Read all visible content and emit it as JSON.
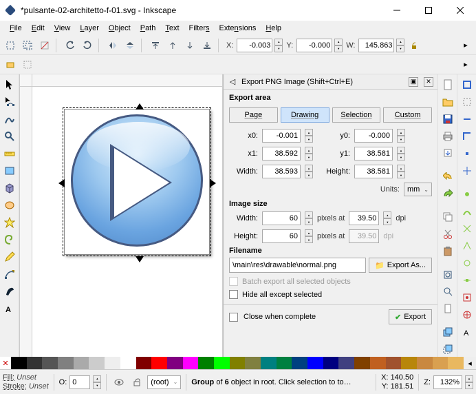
{
  "window": {
    "title": "*pulsante-02-architetto-f-01.svg - Inkscape"
  },
  "menu": [
    "File",
    "Edit",
    "View",
    "Layer",
    "Object",
    "Path",
    "Text",
    "Filters",
    "Extensions",
    "Help"
  ],
  "coordbar": {
    "x_label": "X:",
    "x_value": "-0.003",
    "y_label": "Y:",
    "y_value": "-0.000",
    "w_label": "W:",
    "w_value": "145.863"
  },
  "export": {
    "panel_title": "Export PNG Image (Shift+Ctrl+E)",
    "area_heading": "Export area",
    "tabs": {
      "page": "Page",
      "drawing": "Drawing",
      "selection": "Selection",
      "custom": "Custom"
    },
    "x0_label": "x0:",
    "x0": "-0.001",
    "y0_label": "y0:",
    "y0": "-0.000",
    "x1_label": "x1:",
    "x1": "38.592",
    "y1_label": "y1:",
    "y1": "38.581",
    "ewidth_label": "Width:",
    "ewidth": "38.593",
    "eheight_label": "Height:",
    "eheight": "38.581",
    "units_label": "Units:",
    "units": "mm",
    "image_heading": "Image size",
    "iw_label": "Width:",
    "iw": "60",
    "ih_label": "Height:",
    "ih": "60",
    "px_at": "pixels at",
    "dpi_w": "39.50",
    "dpi_h": "39.50",
    "dpi_unit": "dpi",
    "file_heading": "Filename",
    "filename": "\\main\\res\\drawable\\normal.png",
    "export_as": "Export As...",
    "batch": "Batch export all selected objects",
    "hide": "Hide all except selected",
    "close_complete": "Close when complete",
    "export": "Export"
  },
  "status": {
    "fill_label": "Fill:",
    "fill_val": "Unset",
    "stroke_label": "Stroke:",
    "stroke_val": "Unset",
    "o_label": "O:",
    "o_val": "0",
    "layer": "(root)",
    "msg": "Group of 6 object in root. Click selection to to…",
    "x_label": "X:",
    "x_val": "140.50",
    "y_label": "Y:",
    "y_val": "181.51",
    "z_label": "Z:",
    "z_val": "132%"
  },
  "palette_colors": [
    "#000",
    "#333",
    "#555",
    "#808080",
    "#aaa",
    "#ccc",
    "#eee",
    "#fff",
    "#800000",
    "#f00",
    "#800080",
    "#f0f",
    "#008000",
    "#0f0",
    "#808000",
    "#808040",
    "#008080",
    "#008040",
    "#004080",
    "#00f",
    "#000080",
    "#404080",
    "#804000",
    "#c06020",
    "#a0522d",
    "#b8860b",
    "#c98840",
    "#d9a050",
    "#e9b860"
  ]
}
